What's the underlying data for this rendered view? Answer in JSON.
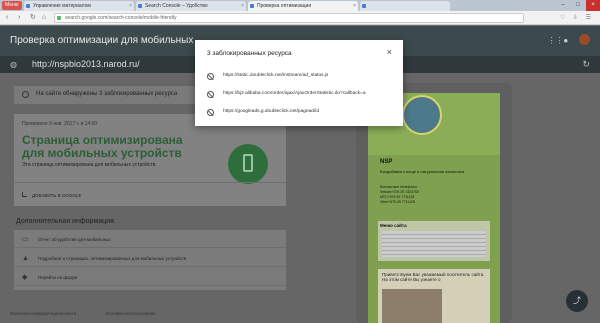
{
  "browser": {
    "menu_label": "Меню",
    "tabs": [
      {
        "label": "Управление материалом"
      },
      {
        "label": "Search Console – Удобство"
      },
      {
        "label": "Проверка оптимизации"
      },
      {
        "label": ""
      }
    ],
    "url": "search.google.com/search-console/mobile-friendly"
  },
  "header": {
    "title": "Проверка оптимизации для мобильных"
  },
  "url_bar": {
    "site": "http://nspbio2013.narod.ru/"
  },
  "notice": {
    "text": "На сайте обнаружены 3 заблокированных ресурса"
  },
  "result": {
    "date": "Проверено 9 янв. 2017 г. в 14:00",
    "title": "Страница оптимизирована для мобильных устройств",
    "subtitle": "Эта страница оптимизирована для мобильных устройств.",
    "share_label": "ДОБАВИТЬ В GOOGLE"
  },
  "additional": {
    "title": "Дополнительная информация",
    "items": [
      {
        "label": "Отчет об удобстве для мобильных"
      },
      {
        "label": "Подробнее о страницах, оптимизированных для мобильных устройств"
      },
      {
        "label": "Перейти на форум"
      }
    ]
  },
  "footer": {
    "privacy": "Политика конфиденциальности",
    "terms": "Условия использования"
  },
  "preview": {
    "heading": "NSP",
    "subtitle": "Биодобавки к пище и натуральная косметика",
    "contacts": [
      "Контактные телефоны:",
      "Velcom+375 29 1323750",
      "МТС+375 29 7711125",
      "Viber+375 29 7711125"
    ],
    "menu_title": "Меню сайта",
    "welcome": "Приветствуем Вас уважаемый посетитель сайта. На этом сайте Вы узнаете о"
  },
  "modal": {
    "title": "3 заблокированных ресурса",
    "resources": [
      "https://static.doubleclick.net/instream/ad_status.js",
      "https://bj2.alibaba.com/order/ajax/AjaxOrderStatistic.do?callback=a",
      "https://googleads.g.doubleclick.net/pagead/id"
    ]
  },
  "colors": {
    "header_bg": "#3d4a4d",
    "success_green": "#2e6e3c",
    "overlay": "#666666"
  }
}
